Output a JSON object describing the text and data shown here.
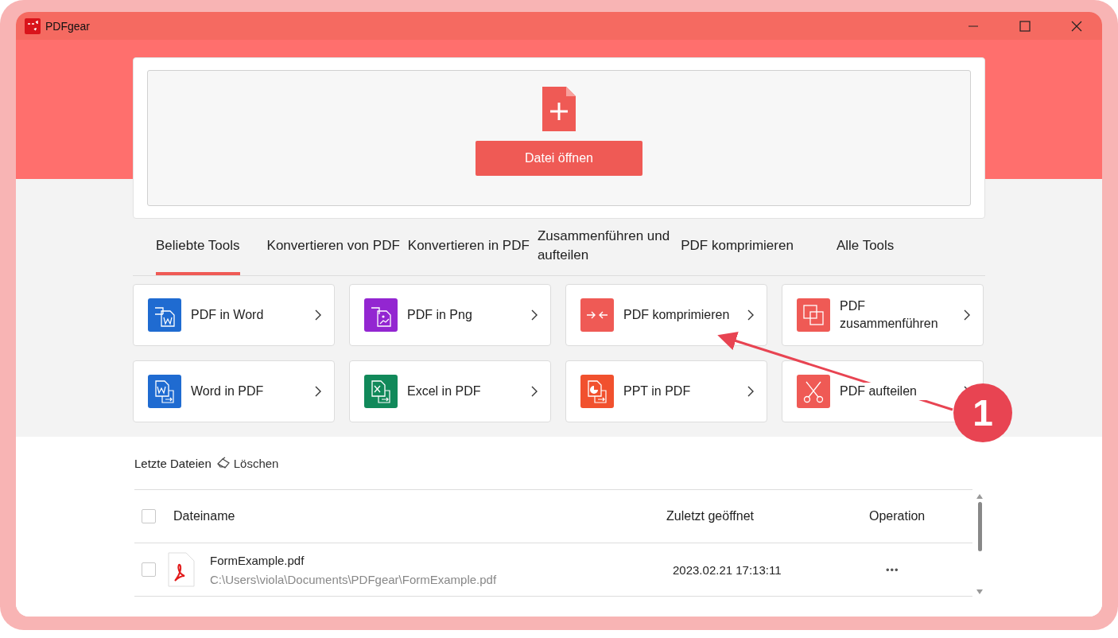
{
  "window": {
    "title": "PDFgear"
  },
  "open_panel": {
    "button": "Datei öffnen"
  },
  "tabs": [
    {
      "label": "Beliebte Tools",
      "selected": true
    },
    {
      "label": "Konvertieren von PDF",
      "selected": false
    },
    {
      "label": "Konvertieren in PDF",
      "selected": false
    },
    {
      "label": "Zusammenführen und\naufteilen",
      "selected": false
    },
    {
      "label": "PDF komprimieren",
      "selected": false
    },
    {
      "label": "Alle Tools",
      "selected": false
    }
  ],
  "tools": [
    {
      "label": "PDF in Word",
      "kind": "to-word",
      "color": "#1f6bd1"
    },
    {
      "label": "PDF in Png",
      "kind": "to-image",
      "color": "#9326d1"
    },
    {
      "label": "PDF komprimieren",
      "kind": "compress",
      "color": "#ef5a55"
    },
    {
      "label": "PDF\nzusammenführen",
      "kind": "merge",
      "color": "#ef5a55"
    },
    {
      "label": "Word in PDF",
      "kind": "from-word",
      "color": "#1f6bd1"
    },
    {
      "label": "Excel in PDF",
      "kind": "from-excel",
      "color": "#11895a"
    },
    {
      "label": "PPT in PDF",
      "kind": "from-ppt",
      "color": "#f1512e"
    },
    {
      "label": "PDF aufteilen",
      "kind": "split",
      "color": "#ef5a55"
    }
  ],
  "recent": {
    "title": "Letzte Dateien",
    "clear": "Löschen",
    "columns": [
      {
        "label": "Dateiname"
      },
      {
        "label": "Zuletzt geöffnet"
      },
      {
        "label": "Operation"
      }
    ],
    "header_checked": false,
    "rows": [
      {
        "name": "FormExample.pdf",
        "path": "C:\\Users\\viola\\Documents\\PDFgear\\FormExample.pdf",
        "opened": "2023.02.21 17:13:11",
        "menu": "•••",
        "checked": false
      }
    ]
  },
  "annotation": {
    "label": "1"
  }
}
